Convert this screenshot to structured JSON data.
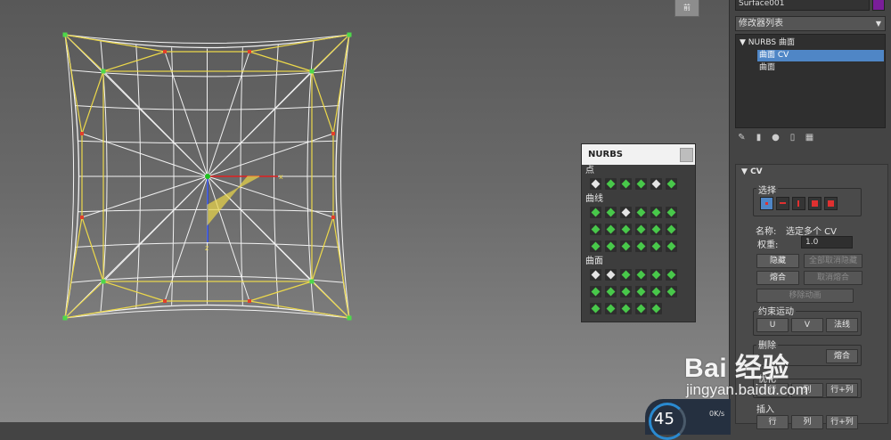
{
  "viewport": {
    "viewcube_label": "前",
    "colors": {
      "cage": "#ecd84a",
      "wire": "#f2f2f2",
      "cv_corner": "#4ed84a",
      "cv_point": "#e2402a",
      "gizmo_x": "#e02020",
      "gizmo_y": "#20c020",
      "gizmo_z": "#2040e0"
    }
  },
  "nurbs_toolbox": {
    "title": "NURBS",
    "sections": {
      "points": "点",
      "curves": "曲线",
      "surfaces": "曲面"
    }
  },
  "panel": {
    "object_name": "Surface001",
    "object_color": "#7a1e9a",
    "modifier_list": "修改器列表",
    "stack": {
      "root": "NURBS 曲面",
      "sub1": "曲面 CV",
      "sub2": "曲面"
    },
    "rollout": {
      "title": "CV",
      "selection_group": "选择",
      "name_label": "名称:",
      "name_value": "选定多个 CV",
      "weight_label": "权重:",
      "weight_value": "1.0",
      "hide": "隐藏",
      "unhide_all": "全部取消隐藏",
      "fuse": "熔合",
      "unfuse": "取消熔合",
      "remove_anim": "移除动画",
      "constrain_group": "约束运动",
      "u": "U",
      "v": "V",
      "normal": "法线",
      "insert_label": "插入",
      "row_btn": "行",
      "col_btn": "列",
      "row_col_btn": "行+列",
      "delete_label": "删除",
      "fuse_label": "熔合",
      "refine_label": "优化",
      "fuse2_btn": "熔合"
    }
  },
  "watermark": {
    "brand": "Bai 经验",
    "url": "jingyan.baidu.com"
  },
  "gauge": {
    "value": "45",
    "speed": "0K/s"
  }
}
